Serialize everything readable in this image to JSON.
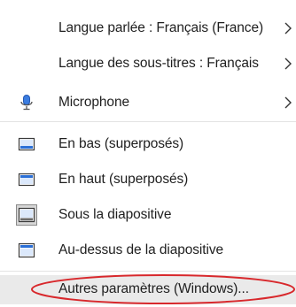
{
  "menu": {
    "items": [
      {
        "label": "Langue parlée : Français (France)",
        "submenu": true
      },
      {
        "label": "Langue des sous-titres : Français",
        "submenu": true
      },
      {
        "label": "Microphone",
        "submenu": true,
        "icon": "microphone-icon"
      },
      {
        "label": "En bas (superposés)",
        "icon": "caption-bottom-overlay-icon"
      },
      {
        "label": "En haut (superposés)",
        "icon": "caption-top-overlay-icon"
      },
      {
        "label": "Sous la diapositive",
        "icon": "caption-below-slide-icon",
        "selected": true
      },
      {
        "label": "Au-dessus de la diapositive",
        "icon": "caption-above-slide-icon"
      },
      {
        "label": "Autres paramètres (Windows)...",
        "highlighted": true
      }
    ],
    "colors": {
      "accent_blue": "#2b6fd6",
      "annotation_red": "#d8282c",
      "hover_bg": "#eaeaea"
    }
  }
}
